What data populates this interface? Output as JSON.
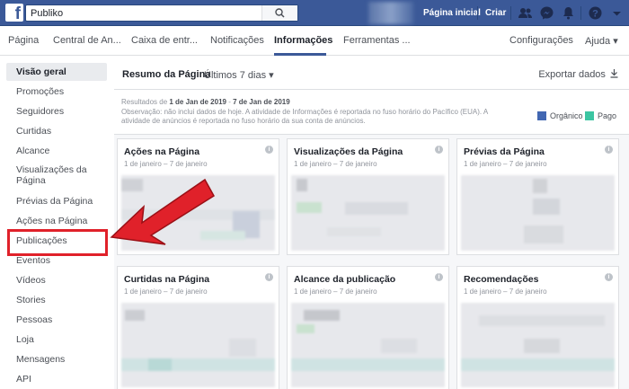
{
  "topbar": {
    "logo": "f",
    "search_value": "Publiko",
    "links": [
      "Página inicial",
      "Criar"
    ],
    "icons": [
      "friends-icon",
      "messenger-icon",
      "notifications-icon",
      "help-icon",
      "dropdown-icon"
    ]
  },
  "pagenav": {
    "tabs": [
      "Página",
      "Central de An...",
      "Caixa de entr...",
      "Notificações",
      "Informações",
      "Ferramentas ..."
    ],
    "active_tab": "Informações",
    "right": [
      "Configurações",
      "Ajuda ▾"
    ]
  },
  "sidebar": {
    "items": [
      "Visão geral",
      "Promoções",
      "Seguidores",
      "Curtidas",
      "Alcance",
      "Visualizações da Página",
      "Prévias da Página",
      "Ações na Página",
      "Publicações",
      "Eventos",
      "Vídeos",
      "Stories",
      "Pessoas",
      "Loja",
      "Mensagens",
      "API"
    ],
    "active": "Visão geral",
    "highlighted": "Publicações"
  },
  "main": {
    "title": "Resumo da Página",
    "range": "Últimos 7 dias ▾",
    "export": "Exportar dados",
    "results_prefix": "Resultados de ",
    "results_from": "1 de Jan de 2019",
    "results_mid": " - ",
    "results_to": "7 de Jan de 2019",
    "note_line1": "Observação: não inclui dados de hoje. A atividade de Informações é reportada no fuso horário do Pacífico (EUA). A",
    "note_line2": "atividade de anúncios é reportada no fuso horário da sua conta de anúncios.",
    "legend": [
      {
        "label": "Orgânico",
        "color": "#4267b2"
      },
      {
        "label": "Pago",
        "color": "#3cc5a2"
      }
    ]
  },
  "cards": [
    {
      "title": "Ações na Página",
      "range": "1 de janeiro – 7 de janeiro"
    },
    {
      "title": "Visualizações da Página",
      "range": "1 de janeiro – 7 de janeiro"
    },
    {
      "title": "Prévias da Página",
      "range": "1 de janeiro – 7 de janeiro"
    },
    {
      "title": "Curtidas na Página",
      "range": "1 de janeiro – 7 de janeiro"
    },
    {
      "title": "Alcance da publicação",
      "range": "1 de janeiro – 7 de janeiro"
    },
    {
      "title": "Recomendações",
      "range": "1 de janeiro – 7 de janeiro"
    }
  ],
  "colors": {
    "brand": "#3b5998",
    "highlight": "#e0212a"
  }
}
